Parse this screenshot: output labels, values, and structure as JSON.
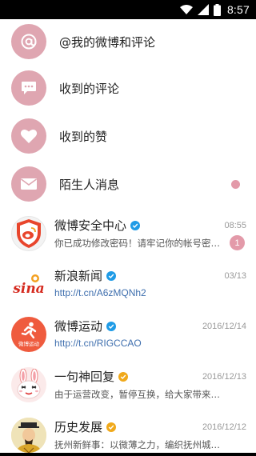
{
  "status_bar": {
    "time": "8:57",
    "icons": [
      "wifi-icon",
      "signal-icon",
      "battery-icon"
    ]
  },
  "menu": [
    {
      "label": "@我的微博和评论",
      "icon": "at-icon"
    },
    {
      "label": "收到的评论",
      "icon": "comment-icon"
    },
    {
      "label": "收到的赞",
      "icon": "heart-icon"
    },
    {
      "label": "陌生人消息",
      "icon": "mail-icon",
      "has_dot": true
    }
  ],
  "messages": [
    {
      "name": "微博安全中心",
      "time": "08:55",
      "text": "你已成功修改密码！请牢记你的帐号密码…",
      "badge": "1",
      "verified": "blue",
      "avatar": "weibo-security-avatar"
    },
    {
      "name": "新浪新闻",
      "time": "03/13",
      "text": "http://t.cn/A6zMQNh2",
      "verified": "blue",
      "avatar": "sina-news-avatar",
      "avatar_text": "sina"
    },
    {
      "name": "微博运动",
      "time": "2016/12/14",
      "text": "http://t.cn/RIGCCAO",
      "verified": "blue",
      "avatar": "weibo-sport-avatar",
      "avatar_text": "微博运动"
    },
    {
      "name": "一句神回复",
      "time": "2016/12/13",
      "text": "由于运营改变，暂停互换，给大家带来…",
      "verified": "gold",
      "avatar": "rabbit-avatar"
    },
    {
      "name": "历史发展",
      "time": "2016/12/12",
      "text": "抚州新鲜事：以微薄之力，编织抚州城…",
      "verified": "gold",
      "avatar": "history-avatar"
    }
  ],
  "colors": {
    "accent_pink": "#dfa6b1",
    "badge_pink": "#e39aa9",
    "link_blue": "#3f6fae",
    "verify_blue": "#1f9be6",
    "verify_gold": "#f0a91b"
  }
}
